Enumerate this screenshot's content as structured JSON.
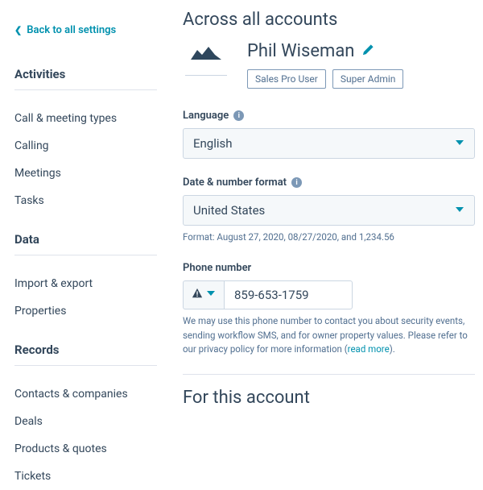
{
  "back_link": "Back to all settings",
  "sidebar": {
    "sections": [
      {
        "header": "Activities",
        "items": [
          "Call & meeting types",
          "Calling",
          "Meetings",
          "Tasks"
        ]
      },
      {
        "header": "Data",
        "items": [
          "Import & export",
          "Properties"
        ]
      },
      {
        "header": "Records",
        "items": [
          "Contacts & companies",
          "Deals",
          "Products & quotes",
          "Tickets"
        ]
      }
    ]
  },
  "main": {
    "heading": "Across all accounts",
    "profile_name": "Phil Wiseman",
    "badges": [
      "Sales Pro User",
      "Super Admin"
    ],
    "language": {
      "label": "Language",
      "value": "English"
    },
    "date_format": {
      "label": "Date & number format",
      "value": "United States",
      "helper": "Format: August 27, 2020, 08/27/2020, and 1,234.56"
    },
    "phone": {
      "label": "Phone number",
      "value": "859-653-1759",
      "helper_pre": "We may use this phone number to contact you about security events, sending workflow SMS, and for owner property values. Please refer to our privacy policy for more information (",
      "helper_link": "read more",
      "helper_post": ")."
    },
    "subheading": "For this account"
  }
}
